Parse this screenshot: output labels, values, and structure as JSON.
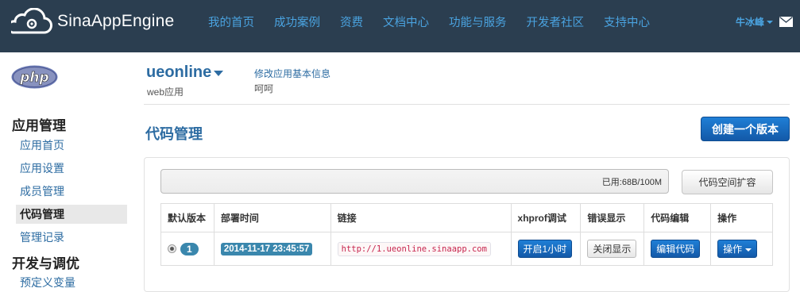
{
  "topbar": {
    "logo_text": "SinaAppEngine",
    "nav": [
      "我的首页",
      "成功案例",
      "资费",
      "文档中心",
      "功能与服务",
      "开发者社区",
      "支持中心"
    ],
    "user": "牛冰峰"
  },
  "app": {
    "name": "ueonline",
    "type": "web应用",
    "edit_link": "修改应用基本信息",
    "description": "呵呵",
    "lang_logo": "php"
  },
  "sidebar": {
    "sections": [
      {
        "title": "应用管理",
        "items": [
          "应用首页",
          "应用设置",
          "成员管理",
          "代码管理",
          "管理记录"
        ]
      },
      {
        "title": "开发与调优",
        "items": [
          "预定义变量"
        ]
      }
    ],
    "active": "代码管理"
  },
  "main": {
    "title": "代码管理",
    "create_button": "创建一个版本",
    "usage": "已用:68B/100M",
    "expand_button": "代码空间扩容",
    "table": {
      "headers": [
        "默认版本",
        "部署时间",
        "链接",
        "xhprof调试",
        "错误显示",
        "代码编辑",
        "操作"
      ],
      "rows": [
        {
          "version": "1",
          "deploy_time": "2014-11-17 23:45:57",
          "link": "http://1.ueonline.sinaapp.com",
          "xhprof": "开启1小时",
          "error_display": "关闭显示",
          "code_edit": "编辑代码",
          "action": "操作"
        }
      ]
    }
  },
  "colors": {
    "topbar_bg": "#2b3e50",
    "nav_link": "#4aa3e0",
    "link_blue": "#2d6ca2",
    "badge": "#3a87ad",
    "primary_button": "#1766b8"
  }
}
